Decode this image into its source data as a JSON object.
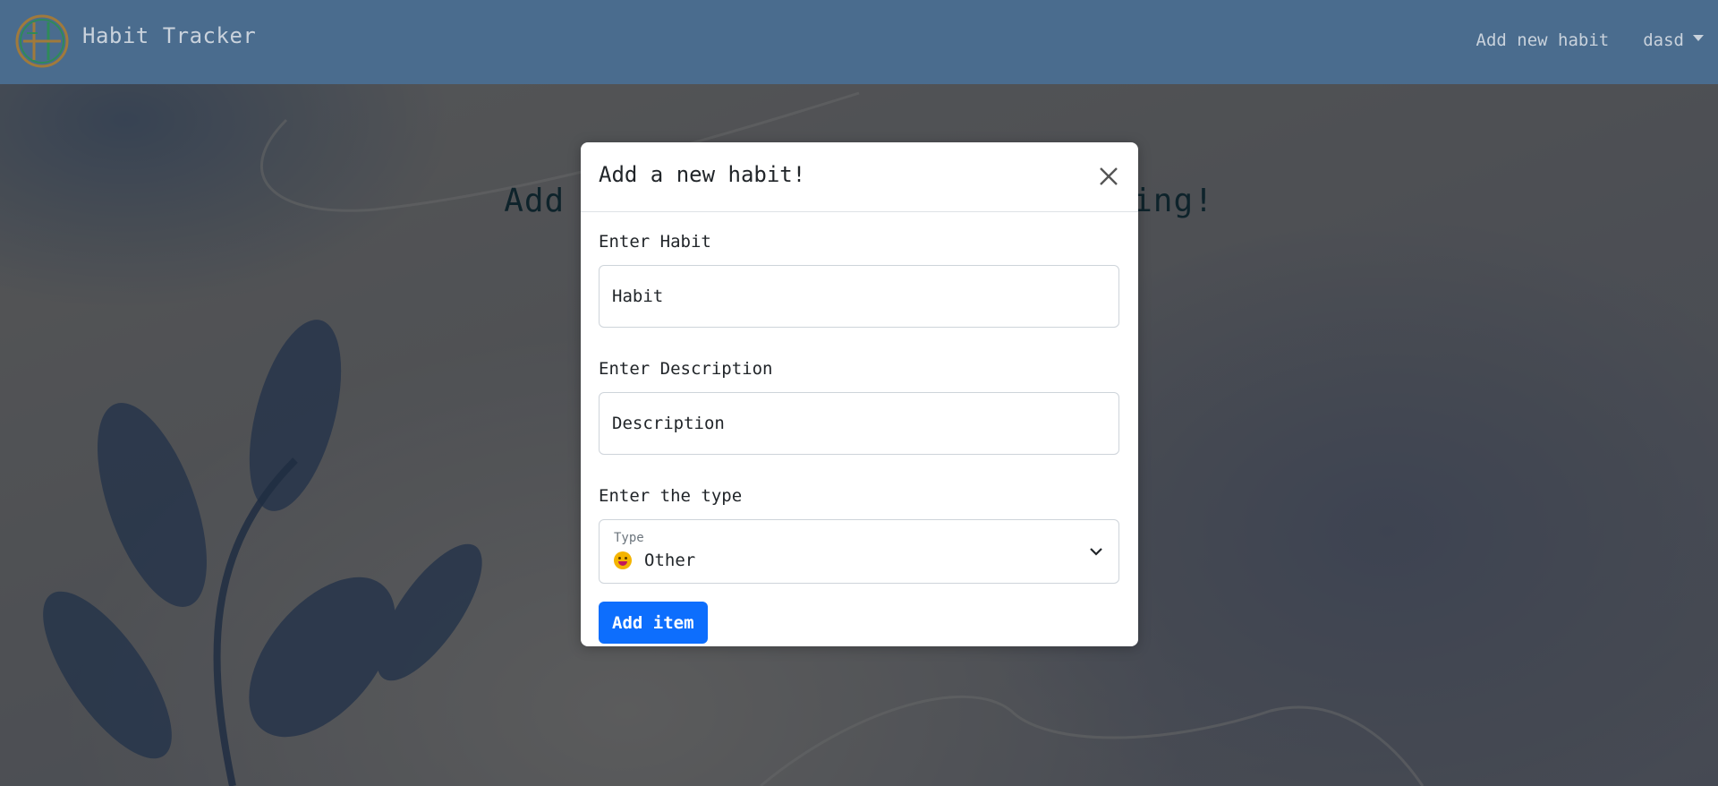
{
  "navbar": {
    "brand_name": "Habit Tracker",
    "logo_icon": "habit-logo-icon",
    "add_link": "Add new habit",
    "user_name": "dasd"
  },
  "page": {
    "heading": "Add your habits and start tracking!"
  },
  "modal": {
    "title": "Add a new habit!",
    "habit": {
      "label": "Enter Habit",
      "placeholder": "Habit",
      "value": ""
    },
    "description": {
      "label": "Enter Description",
      "placeholder": "Description",
      "value": ""
    },
    "type": {
      "label": "Enter the type",
      "small_label": "Type",
      "selected": "Other",
      "selected_icon": "grinning-face-emoji"
    },
    "submit_label": "Add item"
  },
  "colors": {
    "navbar": "#4a6c8e",
    "primary_button": "#0d6efd",
    "heading": "#1c4656"
  }
}
